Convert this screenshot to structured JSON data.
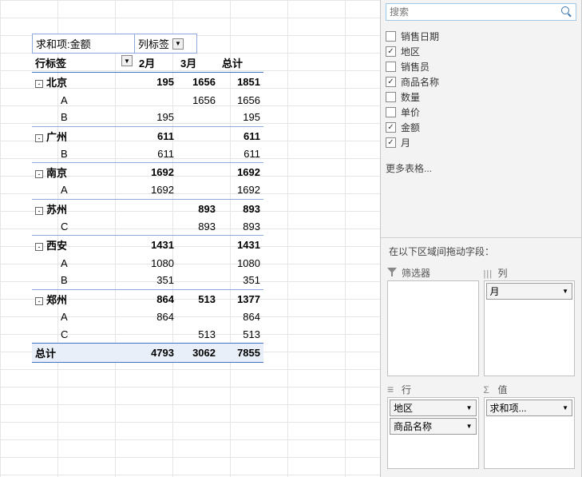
{
  "pivot": {
    "value_field": "求和项:金额",
    "col_label": "列标签",
    "row_label": "行标签",
    "columns": [
      "2月",
      "3月",
      "总计"
    ],
    "groups": [
      {
        "city": "北京",
        "sums": [
          "195",
          "1656",
          "1851"
        ],
        "rows": [
          {
            "label": "A",
            "vals": [
              "",
              "1656",
              "1656"
            ]
          },
          {
            "label": "B",
            "vals": [
              "195",
              "",
              "195"
            ]
          }
        ]
      },
      {
        "city": "广州",
        "sums": [
          "611",
          "",
          "611"
        ],
        "rows": [
          {
            "label": "B",
            "vals": [
              "611",
              "",
              "611"
            ]
          }
        ]
      },
      {
        "city": "南京",
        "sums": [
          "1692",
          "",
          "1692"
        ],
        "rows": [
          {
            "label": "A",
            "vals": [
              "1692",
              "",
              "1692"
            ]
          }
        ]
      },
      {
        "city": "苏州",
        "sums": [
          "",
          "893",
          "893"
        ],
        "rows": [
          {
            "label": "C",
            "vals": [
              "",
              "893",
              "893"
            ]
          }
        ]
      },
      {
        "city": "西安",
        "sums": [
          "1431",
          "",
          "1431"
        ],
        "rows": [
          {
            "label": "A",
            "vals": [
              "1080",
              "",
              "1080"
            ]
          },
          {
            "label": "B",
            "vals": [
              "351",
              "",
              "351"
            ]
          }
        ]
      },
      {
        "city": "郑州",
        "sums": [
          "864",
          "513",
          "1377"
        ],
        "rows": [
          {
            "label": "A",
            "vals": [
              "864",
              "",
              "864"
            ]
          },
          {
            "label": "C",
            "vals": [
              "",
              "513",
              "513"
            ]
          }
        ]
      }
    ],
    "grand": {
      "label": "总计",
      "vals": [
        "4793",
        "3062",
        "7855"
      ]
    }
  },
  "panel": {
    "search_placeholder": "搜索",
    "fields": [
      {
        "label": "销售日期",
        "checked": false
      },
      {
        "label": "地区",
        "checked": true
      },
      {
        "label": "销售员",
        "checked": false
      },
      {
        "label": "商品名称",
        "checked": true
      },
      {
        "label": "数量",
        "checked": false
      },
      {
        "label": "单价",
        "checked": false
      },
      {
        "label": "金额",
        "checked": true
      },
      {
        "label": "月",
        "checked": true
      }
    ],
    "more_tables": "更多表格...",
    "drag_hint": "在以下区域间拖动字段：",
    "areas": {
      "filter": {
        "title": "筛选器",
        "items": []
      },
      "columns": {
        "title": "列",
        "items": [
          "月"
        ]
      },
      "rows": {
        "title": "行",
        "items": [
          "地区",
          "商品名称"
        ]
      },
      "values": {
        "title": "值",
        "items": [
          "求和项..."
        ]
      }
    }
  }
}
